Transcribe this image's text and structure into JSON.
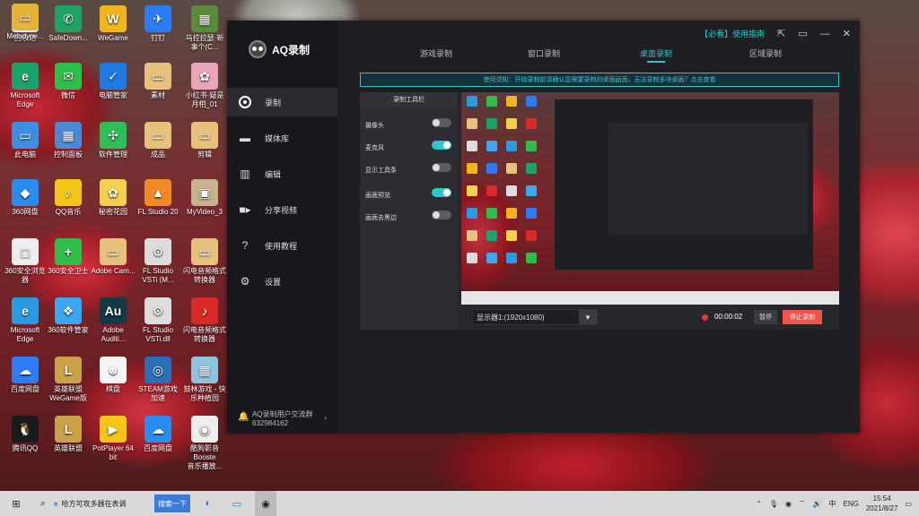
{
  "desktop": {
    "icons": [
      {
        "label": "回收站",
        "x": 0,
        "y": 0,
        "color": "#dfe6ee",
        "glyph": "🗑"
      },
      {
        "label": "SafeDown...",
        "color": "#21a366",
        "glyph": "✆"
      },
      {
        "label": "WeGame",
        "color": "#f2b51d",
        "glyph": "W"
      },
      {
        "label": "钉钉",
        "color": "#2b7cf6",
        "glyph": "✈"
      },
      {
        "label": "乌拉拉瑟·新\n事个(C...",
        "color": "#5a8a3a",
        "glyph": "▦"
      },
      {
        "label": "Microsoft\nEdge",
        "color": "#1aa36b",
        "glyph": "e"
      },
      {
        "label": "微信",
        "color": "#2dbe4b",
        "glyph": "✉"
      },
      {
        "label": "电脑管家",
        "color": "#1f7ae0",
        "glyph": "✓"
      },
      {
        "label": "素材",
        "color": "#e7c27d",
        "glyph": "▭"
      },
      {
        "label": "小红书·疑是\n月相_01",
        "color": "#e9a5b9",
        "glyph": "✿"
      },
      {
        "label": "此电脑",
        "color": "#3d8ee0",
        "glyph": "▭"
      },
      {
        "label": "控制面板",
        "color": "#4a8ad4",
        "glyph": "▦"
      },
      {
        "label": "软件管理",
        "color": "#2fbf59",
        "glyph": "✣"
      },
      {
        "label": "成品",
        "color": "#e7c27d",
        "glyph": "▭"
      },
      {
        "label": "剪辑",
        "color": "#e7c27d",
        "glyph": "▭"
      },
      {
        "label": "360网盘",
        "color": "#2b8cf0",
        "glyph": "◆"
      },
      {
        "label": "QQ音乐",
        "color": "#f4c518",
        "glyph": "♪"
      },
      {
        "label": "秘密花园",
        "color": "#f3d14c",
        "glyph": "✿"
      },
      {
        "label": "FL Studio 20",
        "color": "#f08a24",
        "glyph": "▲"
      },
      {
        "label": "MyVideo_3",
        "color": "#c9b38c",
        "glyph": "▣"
      },
      {
        "label": "360安全浏览\n器",
        "color": "#eeeeee",
        "glyph": "◻"
      },
      {
        "label": "360安全卫士",
        "color": "#2fbf4a",
        "glyph": "+"
      },
      {
        "label": "Adobe Cam...",
        "color": "#e7c27d",
        "glyph": "▭"
      },
      {
        "label": "FL Studio\nVSTi (M...",
        "color": "#dddddd",
        "glyph": "⚙"
      },
      {
        "label": "闪电音频格式\n转换器",
        "color": "#e7c27d",
        "glyph": "▭"
      },
      {
        "label": "Microsoft\nEdge",
        "color": "#2a9be0",
        "glyph": "e"
      },
      {
        "label": "360软件管家",
        "color": "#3ba7f0",
        "glyph": "❖"
      },
      {
        "label": "Adobe\nAuditi...",
        "color": "#123a44",
        "glyph": "Au"
      },
      {
        "label": "FL Studio\nVSTi.dll",
        "color": "#dddddd",
        "glyph": "⚙"
      },
      {
        "label": "闪电音频格式\n转换器",
        "color": "#d92a2a",
        "glyph": "♪"
      },
      {
        "label": "百度网盘",
        "color": "#2e7cf6",
        "glyph": "☁"
      },
      {
        "label": "英雄联盟\nWeGame版",
        "color": "#c9a24a",
        "glyph": "L"
      },
      {
        "label": "棋盘",
        "color": "#f5f5f5",
        "glyph": "☻"
      },
      {
        "label": "STEAM游戏\n加速",
        "color": "#2b6fb8",
        "glyph": "◎"
      },
      {
        "label": "鼓林游戏 - 快\n乐种植园",
        "color": "#8ec4df",
        "glyph": "▦"
      },
      {
        "label": "腾讯QQ",
        "color": "#1b1b1b",
        "glyph": "🐧"
      },
      {
        "label": "英雄联盟",
        "color": "#c9a24a",
        "glyph": "L"
      },
      {
        "label": "PotPlayer 64\nbit",
        "color": "#f5c518",
        "glyph": "▶"
      },
      {
        "label": "百度网盘",
        "color": "#2b8cf0",
        "glyph": "☁"
      },
      {
        "label": "酷狗影音Booste\n音乐播放...",
        "color": "#eeeeee",
        "glyph": "◉"
      },
      {
        "label": "Melodyne...",
        "color": "#e7b23a",
        "glyph": "▭"
      }
    ]
  },
  "app": {
    "name": "AQ录制",
    "top_link": "【必看】使用指南",
    "tabs": [
      "游戏录制",
      "窗口录制",
      "桌面录制",
      "区域录制"
    ],
    "active_tab": 2,
    "nav": [
      {
        "label": "录制",
        "icon": "record-icon"
      },
      {
        "label": "媒体库",
        "icon": "folder-icon"
      },
      {
        "label": "编辑",
        "icon": "film-icon"
      },
      {
        "label": "分享视频",
        "icon": "video-icon"
      },
      {
        "label": "使用教程",
        "icon": "question-icon"
      },
      {
        "label": "设置",
        "icon": "gear-icon"
      }
    ],
    "active_nav": 0,
    "footer": {
      "line1": "AQ录制用户交流群",
      "line2": "632984162"
    },
    "notice": "使用须知：开始录制前请确认您需要录制的桌面画面，无法录制多块桌面？点击查看",
    "options_header": "录制工具栏",
    "options": [
      {
        "label": "摄像头",
        "on": false
      },
      {
        "label": "麦克风",
        "on": true
      },
      {
        "label": "显示工具条",
        "on": false
      },
      {
        "label": "画面预览",
        "on": true
      },
      {
        "label": "画面去黑边",
        "on": false
      }
    ],
    "display_select": "显示器1:(1920x1080)",
    "timer": "00:00:02",
    "pause_label": "暂停",
    "stop_label": "停止录制"
  },
  "taskbar": {
    "search_text": "哈方可攻多器在表调",
    "search_button": "搜索一下",
    "lang": "ENG",
    "time": "15:54",
    "date": "2021/8/27"
  },
  "colors": {
    "accent": "#2ec7c9",
    "stop": "#f0554a",
    "rec": "#e53935"
  }
}
